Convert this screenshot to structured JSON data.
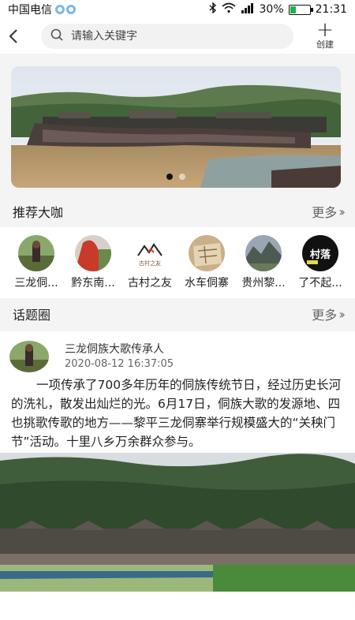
{
  "status_bar": {
    "carrier": "中国电信",
    "battery": "30%",
    "battery_level": 0.3,
    "time": "21:31"
  },
  "header": {
    "search_placeholder": "请输入关键字",
    "create_label": "创建"
  },
  "banner": {
    "slide_count": 2,
    "active_index": 0
  },
  "recommended": {
    "title": "推荐大咖",
    "more_label": "更多",
    "items": [
      {
        "name": "三龙侗..."
      },
      {
        "name": "黔东南..."
      },
      {
        "name": "古村之友",
        "logo_text": "古村之友"
      },
      {
        "name": "水车侗寨"
      },
      {
        "name": "贵州黎..."
      },
      {
        "name": "了不起...",
        "logo_text": "村落"
      }
    ]
  },
  "topics": {
    "title": "话题圈",
    "more_label": "更多",
    "post": {
      "author": "三龙侗族大歌传承人",
      "time": "2020-08-12 16:37:05",
      "body": "一项传承了700多年历年的侗族传统节日，经过历史长河的洗礼，散发出灿烂的光。6月17日，侗族大歌的发源地、四也挑歌传歌的地方——黎平三龙侗寨举行规模盛大的“关秧门节”活动。十里八乡万余群众参与。"
    }
  }
}
